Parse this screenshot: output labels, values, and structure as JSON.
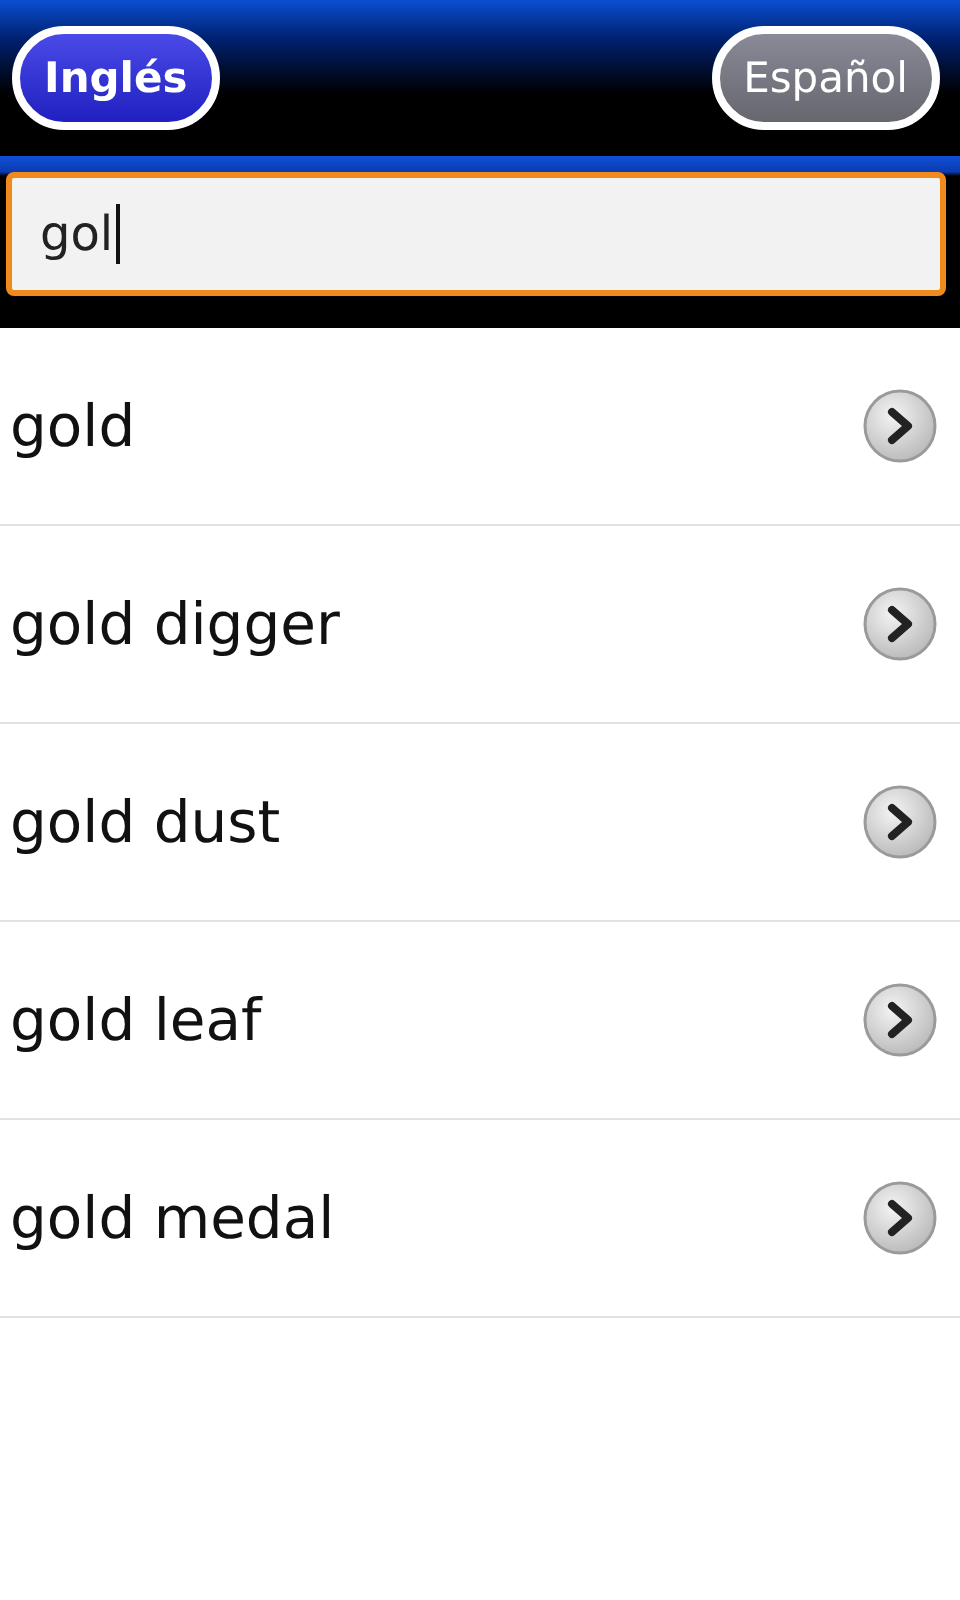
{
  "languages": [
    {
      "label": "Inglés",
      "selected": true
    },
    {
      "label": "Español",
      "selected": false
    }
  ],
  "search": {
    "value": "gol"
  },
  "results": [
    {
      "label": "gold"
    },
    {
      "label": "gold digger"
    },
    {
      "label": "gold dust"
    },
    {
      "label": "gold leaf"
    },
    {
      "label": "gold medal"
    }
  ]
}
